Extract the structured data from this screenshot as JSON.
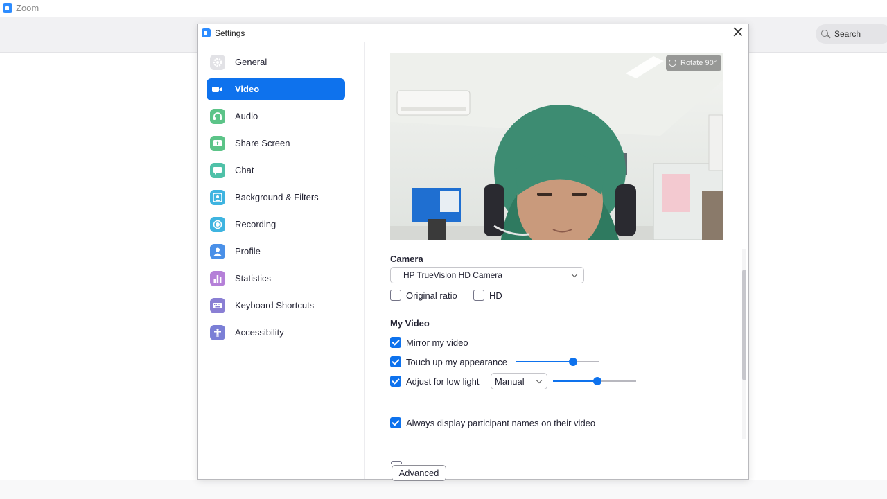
{
  "app": {
    "title": "Zoom",
    "minimize": "—",
    "search_label": "Search"
  },
  "dialog": {
    "title": "Settings"
  },
  "sidebar": {
    "items": [
      {
        "label": "General",
        "icon": "gear-icon",
        "color": "#d8d8dc",
        "active": false
      },
      {
        "label": "Video",
        "icon": "video-camera-icon",
        "color": "#0E72ED",
        "active": true
      },
      {
        "label": "Audio",
        "icon": "headphones-icon",
        "color": "#5cc488",
        "active": false
      },
      {
        "label": "Share Screen",
        "icon": "share-screen-icon",
        "color": "#5cc488",
        "active": false
      },
      {
        "label": "Chat",
        "icon": "chat-bubble-icon",
        "color": "#4fc1a8",
        "active": false
      },
      {
        "label": "Background & Filters",
        "icon": "person-background-icon",
        "color": "#3fb4e0",
        "active": false
      },
      {
        "label": "Recording",
        "icon": "record-icon",
        "color": "#3fb4e0",
        "active": false
      },
      {
        "label": "Profile",
        "icon": "user-icon",
        "color": "#4a90e8",
        "active": false
      },
      {
        "label": "Statistics",
        "icon": "bar-chart-icon",
        "color": "#b580d8",
        "active": false
      },
      {
        "label": "Keyboard Shortcuts",
        "icon": "keyboard-icon",
        "color": "#8a7fd4",
        "active": false
      },
      {
        "label": "Accessibility",
        "icon": "accessibility-icon",
        "color": "#7b7fd6",
        "active": false
      }
    ]
  },
  "video": {
    "rotate_label": "Rotate 90°",
    "camera_title": "Camera",
    "camera_value": "HP TrueVision HD Camera",
    "original_ratio": {
      "label": "Original ratio",
      "checked": false
    },
    "hd": {
      "label": "HD",
      "checked": false
    },
    "my_video_title": "My Video",
    "mirror": {
      "label": "Mirror my video",
      "checked": true
    },
    "touch_up": {
      "label": "Touch up my appearance",
      "checked": true,
      "level": 0.68
    },
    "low_light": {
      "label": "Adjust for low light",
      "checked": true,
      "mode": "Manual",
      "level": 0.53
    },
    "participant_names": {
      "label": "Always display participant names on their video",
      "checked": true
    },
    "advanced_label": "Advanced"
  },
  "colors": {
    "accent": "#0E72ED",
    "brand": "#2D8CFF"
  }
}
